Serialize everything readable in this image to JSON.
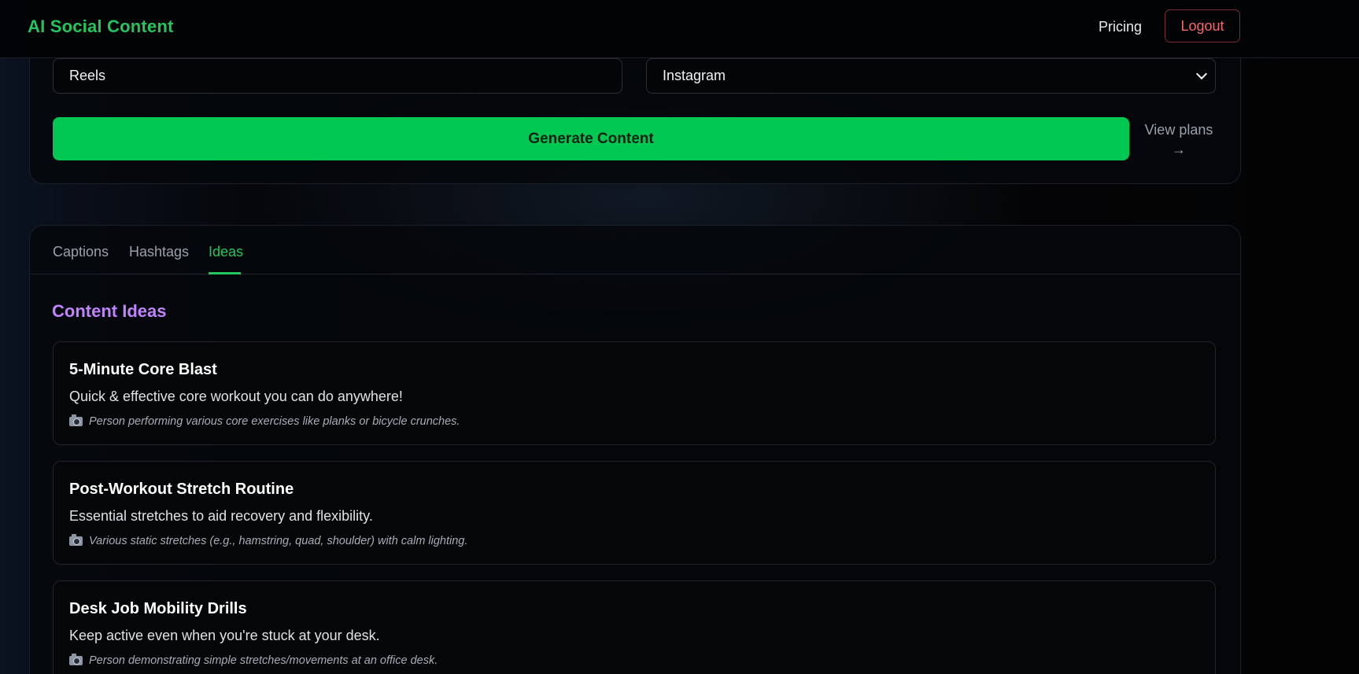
{
  "header": {
    "brand": "AI Social Content",
    "pricing": "Pricing",
    "logout": "Logout"
  },
  "form": {
    "format_value": "Reels",
    "platform_value": "Instagram",
    "generate_label": "Generate Content",
    "view_plans_label": "View plans",
    "view_plans_arrow": "→"
  },
  "tabs": [
    {
      "label": "Captions",
      "active": false
    },
    {
      "label": "Hashtags",
      "active": false
    },
    {
      "label": "Ideas",
      "active": true
    }
  ],
  "ideas": {
    "section_title": "Content Ideas",
    "items": [
      {
        "title": "5-Minute Core Blast",
        "description": "Quick & effective core workout you can do anywhere!",
        "visual": "Person performing various core exercises like planks or bicycle crunches."
      },
      {
        "title": "Post-Workout Stretch Routine",
        "description": "Essential stretches to aid recovery and flexibility.",
        "visual": "Various static stretches (e.g., hamstring, quad, shoulder) with calm lighting."
      },
      {
        "title": "Desk Job Mobility Drills",
        "description": "Keep active even when you're stuck at your desk.",
        "visual": "Person demonstrating simple stretches/movements at an office desk."
      }
    ]
  },
  "icons": {
    "visual_hint": "camera-icon",
    "select_arrow": "chevron-down-icon"
  },
  "colors": {
    "brand_green": "#22c55e",
    "button_green": "#00c853",
    "logout_red": "#f26b6b",
    "section_purple": "#c084fc"
  }
}
